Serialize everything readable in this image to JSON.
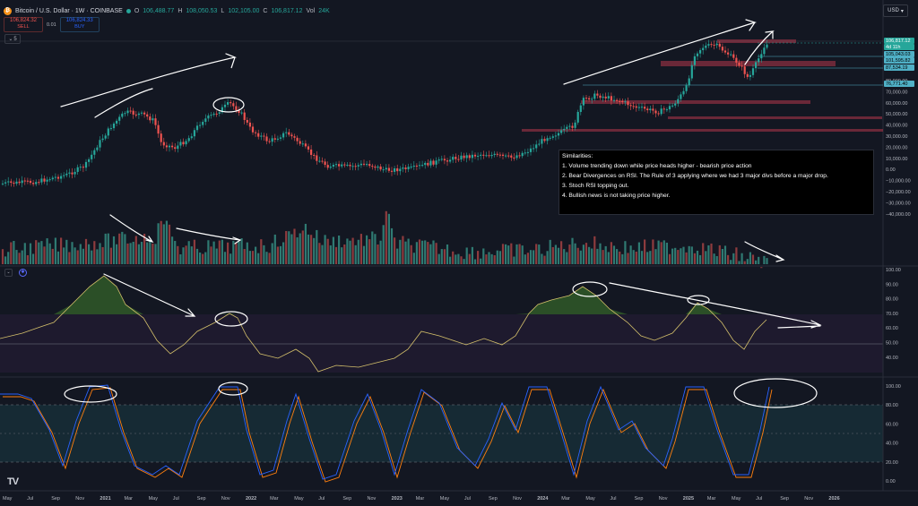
{
  "header": {
    "symbol": "Bitcoin / U.S. Dollar · 1W · COINBASE",
    "open_label": "O",
    "open": "106,488.77",
    "high_label": "H",
    "high": "108,050.53",
    "low_label": "L",
    "low": "102,105.00",
    "close_label": "C",
    "close": "106,817.12",
    "volume_label": "Vol",
    "volume": "24K"
  },
  "trade": {
    "sell_price": "106,824.32",
    "sell_label": "SELL",
    "spread": "0.01",
    "buy_price": "106,824.33",
    "buy_label": "BUY"
  },
  "collapse_label": "5",
  "currency": "USD",
  "price_axis": {
    "ticks": [
      "80,000.00",
      "70,000.00",
      "60,000.00",
      "50,000.00",
      "40,000.00",
      "30,000.00",
      "20,000.00",
      "10,000.00",
      "0.00",
      "−10,000.00",
      "−20,000.00",
      "−30,000.00",
      "−40,000.00"
    ],
    "tags": [
      {
        "text": "106,817.12",
        "bg": "#26a69a",
        "fg": "#ffffff"
      },
      {
        "text": "4d 11h",
        "bg": "#26a69a",
        "fg": "#ffffff"
      },
      {
        "text": "105,043.03",
        "bg": "#4fb0c6",
        "fg": "#000000"
      },
      {
        "text": "101,595.82",
        "bg": "#4fb0c6",
        "fg": "#000000"
      },
      {
        "text": "87,534.19",
        "bg": "#4fb0c6",
        "fg": "#000000"
      },
      {
        "text": "76,771.40",
        "bg": "#4fb0c6",
        "fg": "#000000"
      }
    ]
  },
  "rsi_axis": {
    "ticks": [
      "100.00",
      "90.00",
      "80.00",
      "70.00",
      "60.00",
      "50.00",
      "40.00"
    ]
  },
  "stoch_axis": {
    "ticks": [
      "100.00",
      "80.00",
      "60.00",
      "40.00",
      "20.00",
      "0.00"
    ]
  },
  "time_axis": {
    "labels": [
      "May",
      "Jul",
      "Sep",
      "Nov",
      "2021",
      "Mar",
      "May",
      "Jul",
      "Sep",
      "Nov",
      "2022",
      "Mar",
      "May",
      "Jul",
      "Sep",
      "Nov",
      "2023",
      "Mar",
      "May",
      "Jul",
      "Sep",
      "Nov",
      "2024",
      "Mar",
      "May",
      "Jul",
      "Sep",
      "Nov",
      "2025",
      "Mar",
      "May",
      "Jul",
      "Sep",
      "Nov",
      "2026"
    ]
  },
  "note": {
    "title": "Similarities:",
    "items": [
      "1. Volume trending down while price heads higher - bearish price action",
      "2. Bear Divergences on RSI. The Rule of 3 applying where we had 3 major divs before a major drop.",
      "3. Stoch RSI topping out.",
      "4. Bullish news is not taking price higher."
    ]
  },
  "logo": "TV",
  "colors": {
    "background": "#131722",
    "up": "#26a69a",
    "down": "#ef5350",
    "rsi_line": "#d4c06b",
    "stoch_k": "#2962ff",
    "stoch_d": "#ff7f0e",
    "zone": "#b2374a"
  }
}
